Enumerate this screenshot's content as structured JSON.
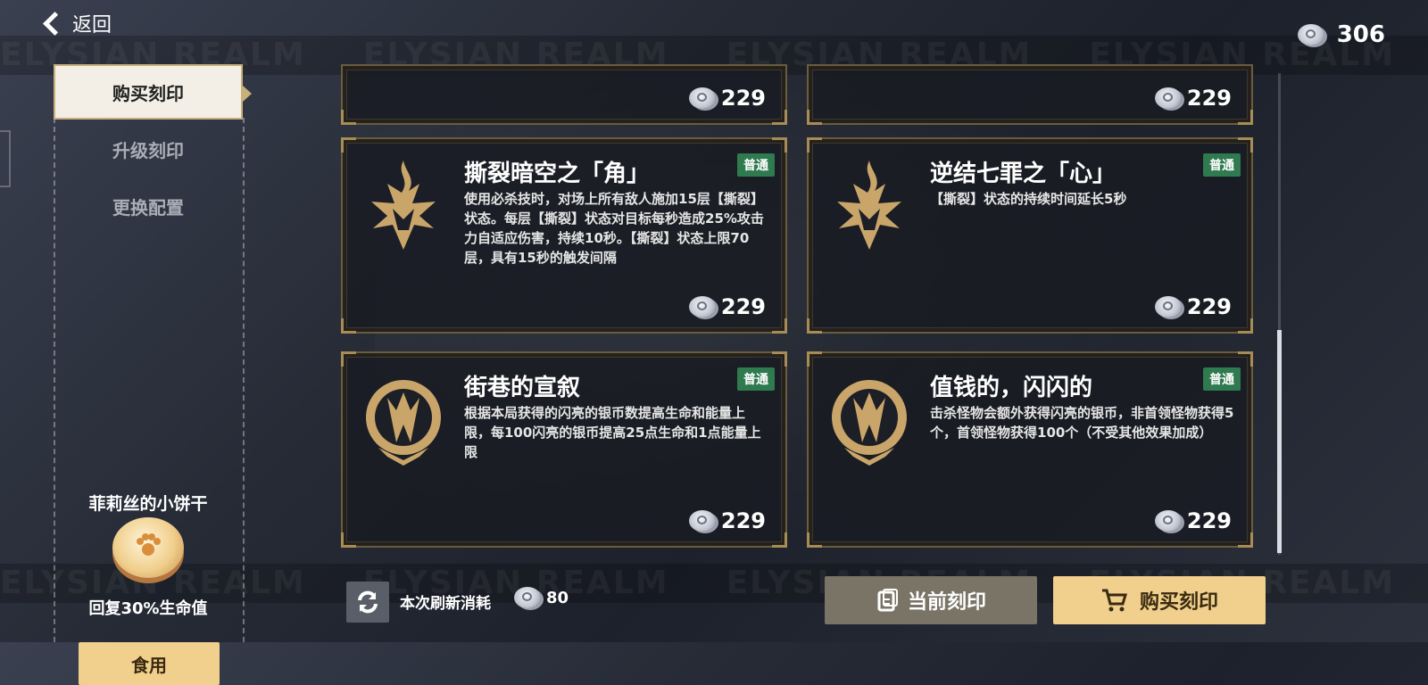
{
  "header": {
    "back_label": "返回",
    "silver_coins": "306"
  },
  "banner_text": "ELYSIAN REALM",
  "sidebar": {
    "tabs": [
      {
        "label": "购买刻印",
        "active": true
      },
      {
        "label": "升级刻印"
      },
      {
        "label": "更换配置"
      }
    ],
    "consumable": {
      "title": "菲莉丝的小饼干",
      "desc": "回复30%生命值",
      "use_label": "食用"
    }
  },
  "cards": {
    "top_left": {
      "price": "229"
    },
    "top_right": {
      "price": "229"
    },
    "c1": {
      "title": "撕裂暗空之「角」",
      "badge": "普通",
      "desc": "使用必杀技时，对场上所有敌人施加15层【撕裂】状态。每层【撕裂】状态对目标每秒造成25%攻击力自适应伤害，持续10秒。【撕裂】状态上限70层，具有15秒的触发间隔",
      "price": "229"
    },
    "c2": {
      "title": "逆结七罪之「心」",
      "badge": "普通",
      "desc": "【撕裂】状态的持续时间延长5秒",
      "price": "229"
    },
    "c3": {
      "title": "街巷的宣叙",
      "badge": "普通",
      "desc": "根据本局获得的闪亮的银币数提高生命和能量上限，每100闪亮的银币提高25点生命和1点能量上限",
      "price": "229"
    },
    "c4": {
      "title": "值钱的，闪闪的",
      "badge": "普通",
      "desc": "击杀怪物会额外获得闪亮的银币，非首领怪物获得5个，首领怪物获得100个（不受其他效果加成）",
      "price": "229"
    }
  },
  "footer": {
    "refresh_label": "本次刷新消耗",
    "refresh_cost": "80",
    "current_label": "当前刻印",
    "buy_label": "购买刻印"
  },
  "colors": {
    "accent_gold": "#f1cf8c",
    "badge_green": "#2f7a4f",
    "frame_gold": "#a88c55"
  }
}
